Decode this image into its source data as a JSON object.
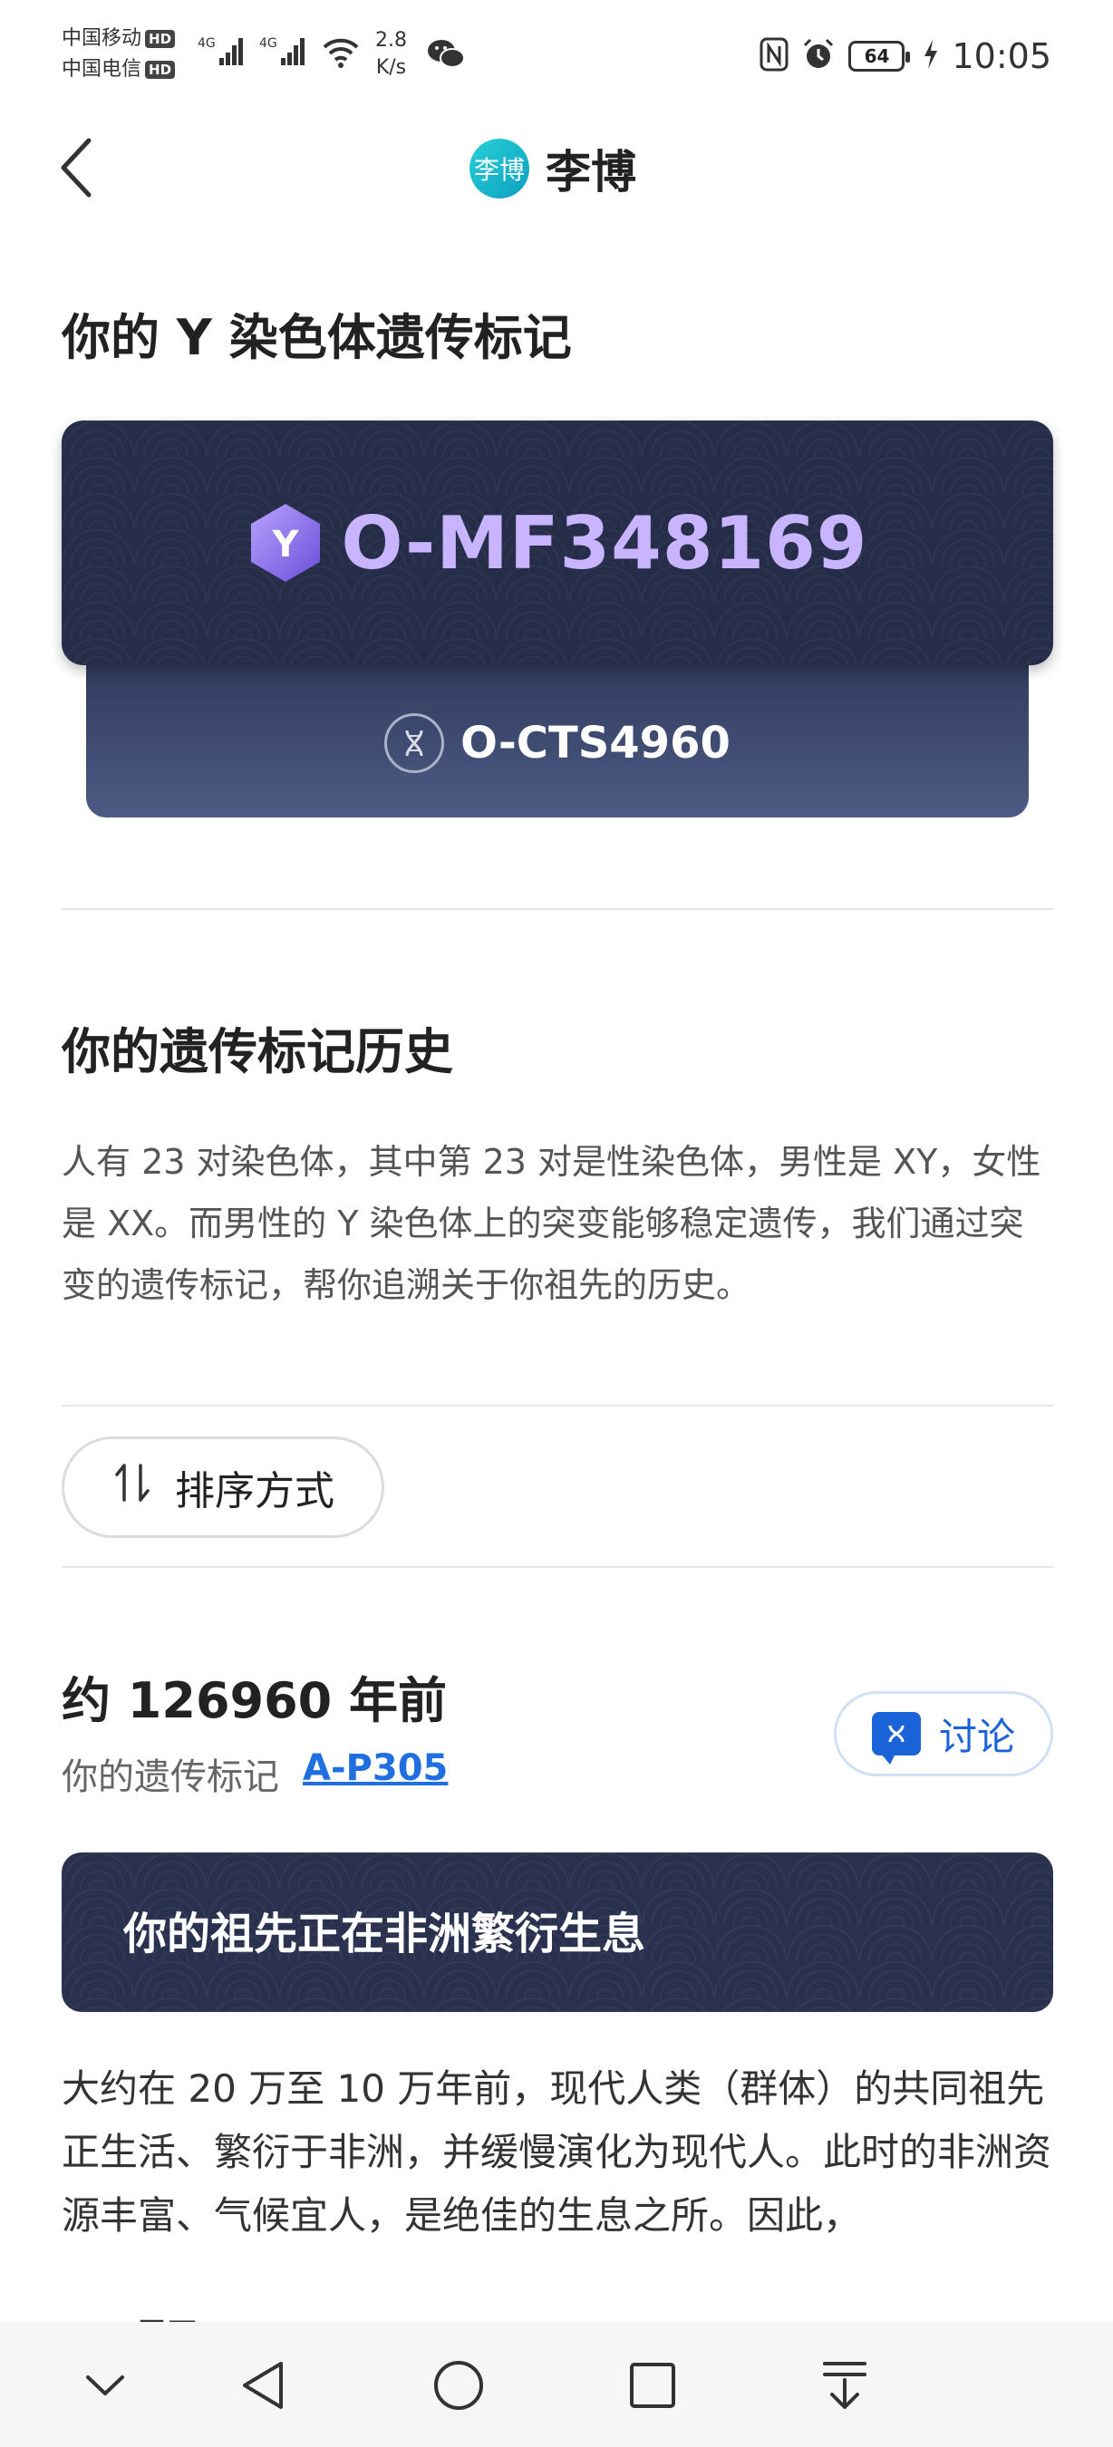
{
  "status_bar": {
    "carrier_1": "中国移动",
    "carrier_2": "中国电信",
    "hd_badge": "HD",
    "net_type": "4G",
    "net_speed_value": "2.8",
    "net_speed_unit": "K/s",
    "battery_level": "64",
    "time": "10:05"
  },
  "header": {
    "avatar_text": "李博",
    "title": "李博"
  },
  "y_marker": {
    "heading": "你的 Y 染色体遗传标记",
    "badge_letter": "Y",
    "haplogroup": "O-MF348169",
    "subclade": "O-CTS4960"
  },
  "history": {
    "heading": "你的遗传标记历史",
    "description": "人有 23 对染色体，其中第 23 对是性染色体，男性是 XY，女性是 XX。而男性的 Y 染色体上的突变能够稳定遗传，我们通过突变的遗传标记，帮你追溯关于你祖先的历史。",
    "sort_label": "排序方式"
  },
  "timeline_item": {
    "era": "约 126960 年前",
    "marker_prefix": "你的遗传标记",
    "marker_link": "A-P305",
    "discuss_label": "讨论",
    "banner_title": "你的祖先正在非洲繁衍生息",
    "story": "大约在 20 万至 10 万年前，现代人类（群体）的共同祖先正生活、繁衍于非洲，并缓慢演化为现代人。此时的非洲资源丰富、气候宜人，是绝佳的生息之所。因此，",
    "expand_label": "展开"
  },
  "system_nav": {
    "icons": [
      "collapse-icon",
      "back-icon",
      "home-icon",
      "recents-icon",
      "pull-down-icon"
    ]
  }
}
